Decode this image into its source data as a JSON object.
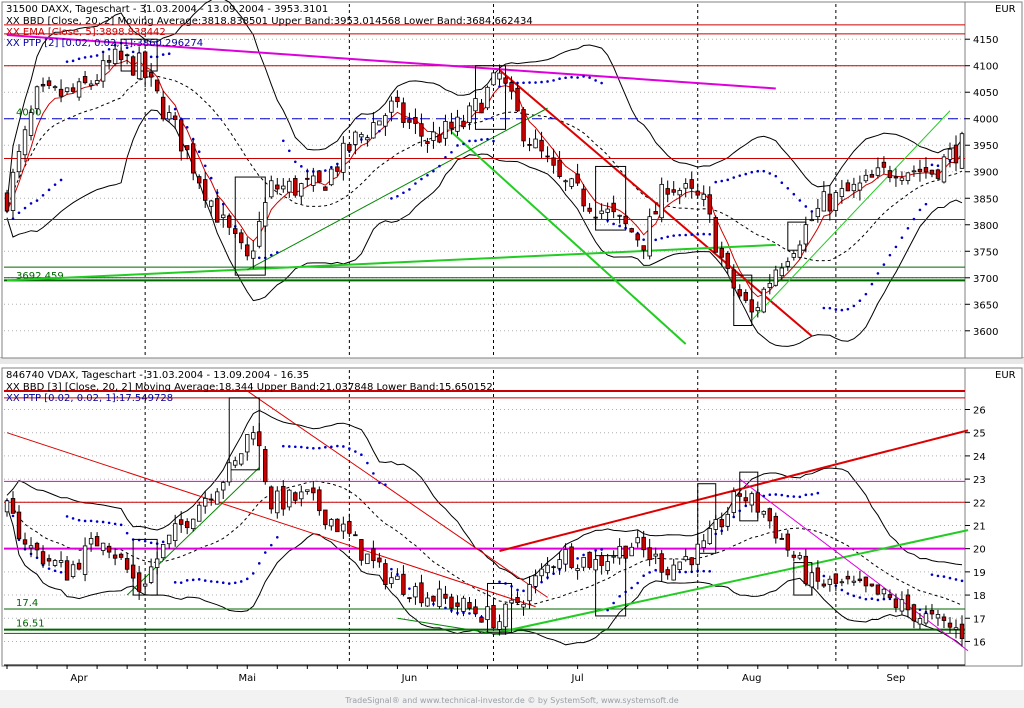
{
  "chart_data": [
    {
      "type": "candlestick",
      "header": "31500  DAXX, Tageschart - 31.03.2004 - 13.09.2004 - 3953.3101",
      "indicators": [
        {
          "text": "XX BBD [Close, 20, 2] Moving Average:3818.838501 Upper Band:3953.014568 Lower Band:3684.662434",
          "color": "#000000"
        },
        {
          "text": "XX EMA [Close, 5]:3898.838442",
          "color": "#cc0000"
        },
        {
          "text": "XX PTP [2] [0.02, 0.02, 1]:3860.296274",
          "color": "#000099"
        }
      ],
      "currency": "EUR",
      "ylim": [
        3560,
        4190
      ],
      "yticks": [
        3600,
        3650,
        3700,
        3750,
        3800,
        3850,
        3900,
        3950,
        4000,
        4050,
        4100,
        4150
      ],
      "level_labels": [
        {
          "text": "4000",
          "value": 4000
        },
        {
          "text": "3692.459",
          "value": 3692.459
        }
      ],
      "hlines": [
        {
          "value": 4177,
          "color": "#cc0000"
        },
        {
          "value": 4160,
          "color": "#cc0000"
        },
        {
          "value": 4100,
          "color": "#cc0000"
        },
        {
          "value": 4000,
          "color": "#0000cc",
          "dash": true
        },
        {
          "value": 3925,
          "color": "#cc0000"
        },
        {
          "value": 3810,
          "color": "#006600"
        },
        {
          "value": 3720,
          "color": "#006600"
        },
        {
          "value": 3700,
          "color": "#006600"
        },
        {
          "value": 3695,
          "color": "#006600",
          "thick": true
        }
      ],
      "trendlines": [
        {
          "x1": 0,
          "y1": 4158,
          "x2": 128,
          "y2": 4057,
          "color": "#dd00dd",
          "width": 2
        },
        {
          "x1": 82,
          "y1": 4092,
          "x2": 134,
          "y2": 3590,
          "color": "#dd0000",
          "width": 2
        },
        {
          "x1": 74,
          "y1": 3975,
          "x2": 113,
          "y2": 3575,
          "color": "#22cc22",
          "width": 2
        },
        {
          "x1": 0,
          "y1": 3695,
          "x2": 128,
          "y2": 3762,
          "color": "#22cc22",
          "width": 2
        },
        {
          "x1": 40,
          "y1": 3715,
          "x2": 90,
          "y2": 4020,
          "color": "#008800",
          "width": 1
        },
        {
          "x1": 124,
          "y1": 3620,
          "x2": 157,
          "y2": 4015,
          "color": "#22cc22",
          "width": 1
        }
      ],
      "rectangles": [
        {
          "x1": 38,
          "x2": 43,
          "y1": 3705,
          "y2": 3890
        },
        {
          "x1": 78,
          "x2": 83,
          "y1": 3980,
          "y2": 4100
        },
        {
          "x1": 98,
          "x2": 103,
          "y1": 3790,
          "y2": 3910
        },
        {
          "x1": 121,
          "x2": 124,
          "y1": 3610,
          "y2": 3705
        },
        {
          "x1": 130,
          "x2": 133,
          "y1": 3752,
          "y2": 3805
        },
        {
          "x1": 19,
          "x2": 25,
          "y1": 4090,
          "y2": 4150
        }
      ],
      "vgrid": [
        23,
        81,
        126
      ]
    },
    {
      "type": "candlestick",
      "header": "846740  VDAX, Tageschart - 31.03.2004 - 13.09.2004 - 16.35",
      "indicators": [
        {
          "text": "XX BBD [3] [Close, 20, 2] Moving Average:18.344 Upper Band:21.037848 Lower Band:15.650152",
          "color": "#000000"
        },
        {
          "text": "XX PTP [0.02, 0.02, 1]:17.549728",
          "color": "#000099"
        }
      ],
      "currency": "EUR",
      "ylim": [
        15.2,
        27.1
      ],
      "yticks": [
        16,
        17,
        18,
        19,
        20,
        21,
        22,
        23,
        24,
        25,
        26
      ],
      "level_labels": [
        {
          "text": "17.4",
          "value": 17.4
        },
        {
          "text": "16.51",
          "value": 16.51
        }
      ],
      "hlines": [
        {
          "value": 26.8,
          "color": "#cc0000",
          "thick": true
        },
        {
          "value": 26.5,
          "color": "#cc0000"
        },
        {
          "value": 22.9,
          "color": "#dd00dd"
        },
        {
          "value": 22.0,
          "color": "#cc0000"
        },
        {
          "value": 20.0,
          "color": "#dd00dd",
          "thick": true
        },
        {
          "value": 17.4,
          "color": "#006600"
        },
        {
          "value": 16.51,
          "color": "#006600",
          "thick": true
        },
        {
          "value": 16.35,
          "color": "#006600"
        }
      ],
      "trendlines": [
        {
          "x1": 82,
          "y1": 19.9,
          "x2": 160,
          "y2": 25.1,
          "color": "#dd0000",
          "width": 2
        },
        {
          "x1": 82,
          "y1": 16.4,
          "x2": 160,
          "y2": 20.8,
          "color": "#22cc22",
          "width": 2
        },
        {
          "x1": 0,
          "y1": 25.0,
          "x2": 88,
          "y2": 17.5,
          "color": "#dd0000",
          "width": 1
        },
        {
          "x1": 40,
          "y1": 26.8,
          "x2": 90,
          "y2": 17.9,
          "color": "#dd0000",
          "width": 1
        },
        {
          "x1": 122,
          "y1": 23.0,
          "x2": 160,
          "y2": 15.6,
          "color": "#dd00dd",
          "width": 1
        },
        {
          "x1": 20,
          "y1": 18.0,
          "x2": 42,
          "y2": 23.5,
          "color": "#008800",
          "width": 1
        },
        {
          "x1": 65,
          "y1": 17.0,
          "x2": 82,
          "y2": 16.3,
          "color": "#008800",
          "width": 1
        }
      ],
      "rectangles": [
        {
          "x1": 21,
          "x2": 25,
          "y1": 18.0,
          "y2": 20.4
        },
        {
          "x1": 37,
          "x2": 42,
          "y1": 23.4,
          "y2": 26.5
        },
        {
          "x1": 80,
          "x2": 84,
          "y1": 16.4,
          "y2": 18.5
        },
        {
          "x1": 98,
          "x2": 103,
          "y1": 17.1,
          "y2": 19.7
        },
        {
          "x1": 115,
          "x2": 118,
          "y1": 19.8,
          "y2": 22.8
        },
        {
          "x1": 122,
          "x2": 125,
          "y1": 21.2,
          "y2": 23.3
        },
        {
          "x1": 131,
          "x2": 134,
          "y1": 18.0,
          "y2": 19.4
        }
      ],
      "vgrid": [
        23,
        81,
        126
      ]
    }
  ],
  "x_axis": {
    "n_bars": 160,
    "labels": [
      {
        "text": "Apr",
        "x": 12
      },
      {
        "text": "Mai",
        "x": 40
      },
      {
        "text": "Jun",
        "x": 67
      },
      {
        "text": "Jul",
        "x": 95
      },
      {
        "text": "Aug",
        "x": 124
      },
      {
        "text": "Sep",
        "x": 148
      }
    ],
    "separators": [
      23,
      57,
      81,
      115,
      138
    ]
  },
  "footer": "TradeSignal® and www.technical-investor.de © by SystemSoft, www.systemsoft.de",
  "colors": {
    "panel_bg": "#ffffff",
    "axis_bg": "#ffffff",
    "frame": "#808080",
    "bull": "#ffffff",
    "bear": "#cc0000",
    "sar": "#0000cc"
  }
}
